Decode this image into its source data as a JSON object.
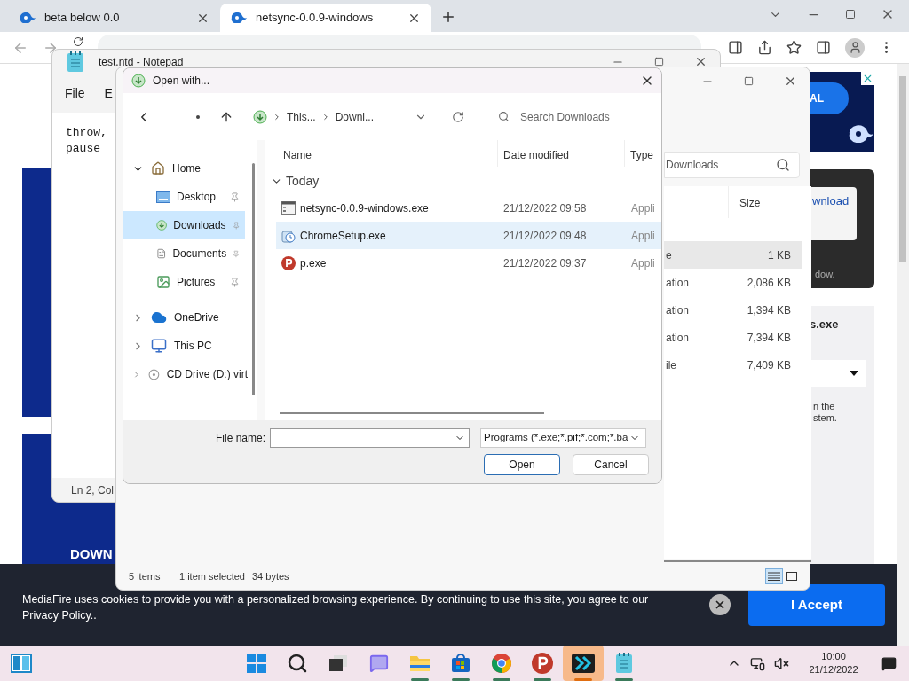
{
  "browser": {
    "tabs": [
      {
        "title": "beta below 0.0",
        "selected": false
      },
      {
        "title": "netsync-0.0.9-windows",
        "selected": true
      }
    ]
  },
  "webpage": {
    "heading_fragment": "DOWN",
    "ad_button_fragment": "AL",
    "download_link_fragment": "wnload",
    "notice_fragment": "dow.",
    "filename_fragment": "s.exe",
    "text_fragments": [
      "n the",
      "stem."
    ]
  },
  "notepad": {
    "title": "test.ntd - Notepad",
    "menu": [
      "File",
      "E"
    ],
    "lines": [
      "throw,",
      "pause"
    ],
    "status": "Ln 2, Col"
  },
  "explorer": {
    "search": "Downloads",
    "size_header": "Size",
    "rows": [
      {
        "type": "e",
        "size": "1 KB",
        "selected": true
      },
      {
        "type": "ation",
        "size": "2,086 KB",
        "selected": false
      },
      {
        "type": "ation",
        "size": "1,394 KB",
        "selected": false
      },
      {
        "type": "ation",
        "size": "7,394 KB",
        "selected": false
      },
      {
        "type": "ile",
        "size": "7,409 KB",
        "selected": false
      }
    ],
    "status": {
      "count": "5 items",
      "selection": "1 item selected",
      "bytes": "34 bytes"
    },
    "views": [
      {
        "kind": "details",
        "selected": true
      },
      {
        "kind": "tiles",
        "selected": false
      }
    ]
  },
  "dialog": {
    "title": "Open with...",
    "breadcrumb": [
      "This...",
      "Downl..."
    ],
    "search_placeholder": "Search Downloads",
    "nav": [
      {
        "label": "Home",
        "kind": "home",
        "expanded": true,
        "children": [
          {
            "label": "Desktop",
            "kind": "desktop",
            "pinned": true,
            "selected": false
          },
          {
            "label": "Downloads",
            "kind": "downloads",
            "pinned": true,
            "selected": true
          },
          {
            "label": "Documents",
            "kind": "documents",
            "pinned": true,
            "selected": false
          },
          {
            "label": "Pictures",
            "kind": "pictures",
            "pinned": true,
            "selected": false
          }
        ]
      },
      {
        "label": "OneDrive",
        "kind": "cloud",
        "expanded": false
      },
      {
        "label": "This PC",
        "kind": "pc",
        "expanded": false
      },
      {
        "label": "CD Drive (D:) virt",
        "kind": "disc",
        "expanded": false
      }
    ],
    "columns": [
      "Name",
      "Date modified",
      "Type"
    ],
    "group": {
      "label": "Today",
      "expanded": true
    },
    "files": [
      {
        "name": "netsync-0.0.9-windows.exe",
        "date": "21/12/2022 09:58",
        "type": "Appli",
        "kind": "window-app",
        "selected": false
      },
      {
        "name": "ChromeSetup.exe",
        "date": "21/12/2022 09:48",
        "type": "Appli",
        "kind": "setup",
        "selected": true
      },
      {
        "name": "p.exe",
        "date": "21/12/2022 09:37",
        "type": "Appli",
        "kind": "p-app",
        "selected": false
      }
    ],
    "file_name_label": "File name:",
    "filter": "Programs (*.exe;*.pif;*.com;*.ba",
    "buttons": [
      "Open",
      "Cancel"
    ]
  },
  "cookie_banner": {
    "message": "MediaFire uses cookies to provide you with a personalized browsing experience. By continuing to use this site, you agree to our Privacy Policy..",
    "accept": "I Accept"
  },
  "taskbar": {
    "apps": [
      {
        "kind": "widgets",
        "running": false,
        "active": false
      },
      {
        "kind": "start",
        "running": false,
        "active": false
      },
      {
        "kind": "search",
        "running": false,
        "active": false
      },
      {
        "kind": "task-view",
        "running": false,
        "active": false
      },
      {
        "kind": "chat",
        "running": false,
        "active": false
      },
      {
        "kind": "folder",
        "running": true,
        "active": false
      },
      {
        "kind": "store",
        "running": true,
        "active": false
      },
      {
        "kind": "chrome",
        "running": true,
        "active": false
      },
      {
        "kind": "p-app",
        "running": true,
        "active": false
      },
      {
        "kind": "arrows-app",
        "running": true,
        "active": true
      },
      {
        "kind": "notepad",
        "running": true,
        "active": false
      }
    ],
    "time": "10:00",
    "date": "21/12/2022"
  }
}
